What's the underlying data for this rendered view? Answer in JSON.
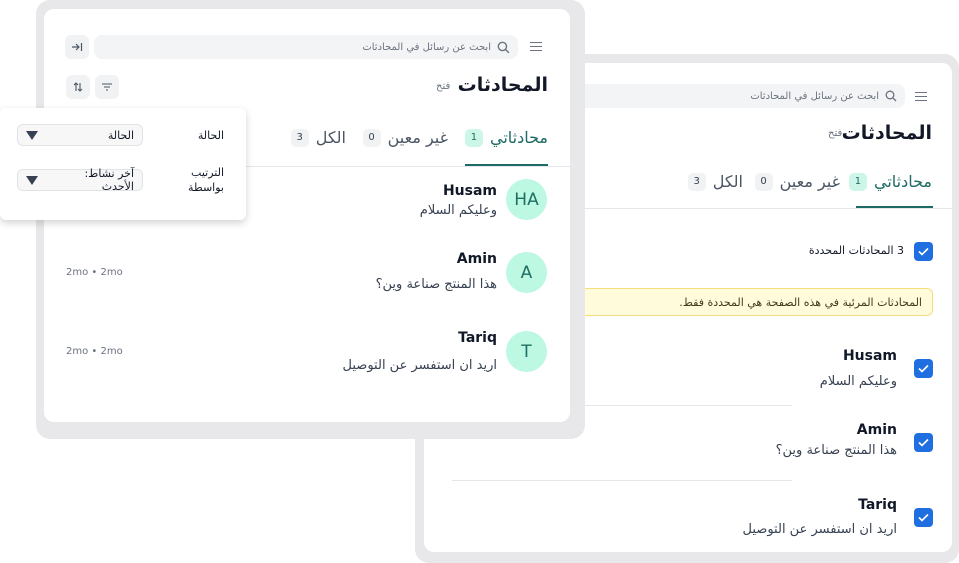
{
  "back_panel": {
    "search_placeholder": "ابحث عن رسائل في المحادثات",
    "title": "المحادثات",
    "status": "فتح",
    "tabs": [
      {
        "label": "محادثاتي",
        "count": "1"
      },
      {
        "label": "غير معين",
        "count": "0"
      },
      {
        "label": "الكل",
        "count": "3"
      }
    ],
    "selection_label": "3 المحادثات المحددة",
    "notice": "المحادثات المرئية في هذه الصفحة هي المحددة فقط.",
    "conversations": [
      {
        "name": "Husam",
        "message": "وعليكم السلام"
      },
      {
        "name": "Amin",
        "message": "هذا المنتج صناعة وين؟"
      },
      {
        "name": "Tariq",
        "message": "اريد ان استفسر عن التوصيل"
      }
    ]
  },
  "front_panel": {
    "search_placeholder": "ابحث عن رسائل في المحادثات",
    "title": "المحادثات",
    "status": "فتح",
    "tabs": [
      {
        "label": "محادثاتي",
        "count": "1"
      },
      {
        "label": "غير معين",
        "count": "0"
      },
      {
        "label": "الكل",
        "count": "3"
      }
    ],
    "conversations": [
      {
        "initials": "HA",
        "name": "Husam",
        "message": "وعليكم السلام",
        "meta": ""
      },
      {
        "initials": "A",
        "name": "Amin",
        "message": "هذا المنتج صناعة وين؟",
        "meta": "2mo • 2mo"
      },
      {
        "initials": "T",
        "name": "Tariq",
        "message": "اريد ان استفسر عن التوصيل",
        "meta": "2mo • 2mo"
      }
    ]
  },
  "filter_popover": {
    "status_label": "الحالة",
    "status_value": "الحالة",
    "sort_label": "الترتيب بواسطة",
    "sort_value": "آخر نشاط: الأحدث"
  },
  "colors": {
    "accent": "#1d6b64",
    "avatar_bg": "#bdf8e3",
    "checkbox": "#1f6fe0",
    "notice_bg": "#fffbdb"
  }
}
